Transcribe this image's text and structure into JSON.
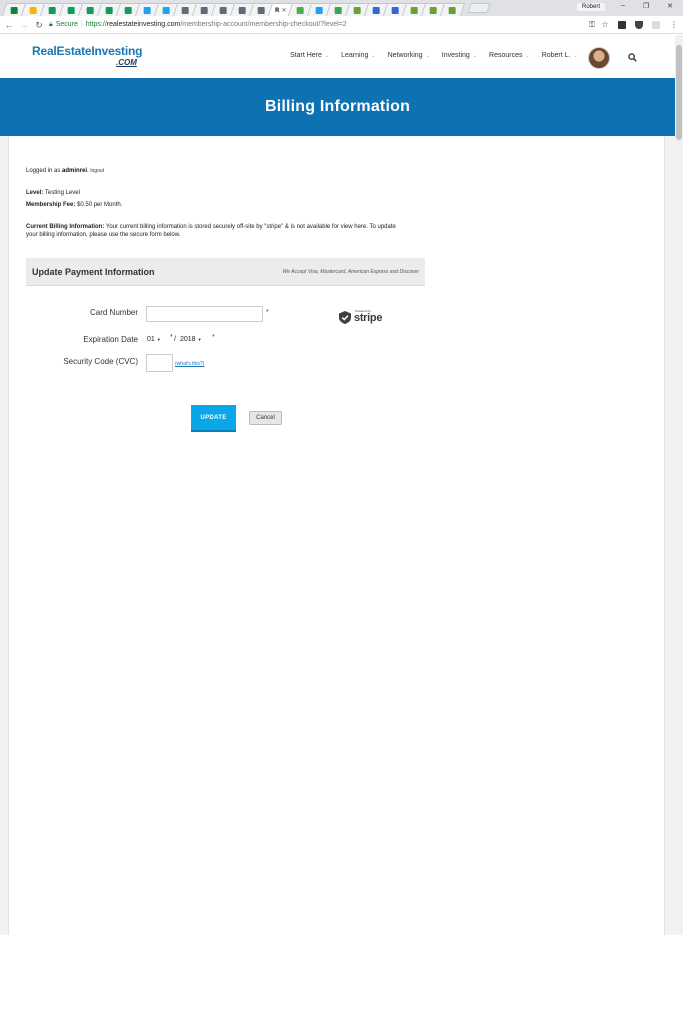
{
  "browser": {
    "user": "Robert",
    "secure_label": "Secure",
    "url_https": "https://",
    "url_host": "realestateinvesting.com",
    "url_path": "/membership-account/membership-checkout/?level=2",
    "active_tab_label": "R",
    "tabs": [
      {
        "icon": "spreadsheet-icon",
        "color": "#1a7f37"
      },
      {
        "icon": "drive-icon",
        "color": "#f4b400"
      },
      {
        "icon": "sheets-icon",
        "color": "#0f9d58"
      },
      {
        "icon": "sheets-icon",
        "color": "#0f9d58"
      },
      {
        "icon": "sheets-icon",
        "color": "#0f9d58"
      },
      {
        "icon": "sheets-icon",
        "color": "#0f9d58"
      },
      {
        "icon": "sheets-icon",
        "color": "#0f9d58"
      },
      {
        "icon": "twitter-icon",
        "color": "#1da1f2"
      },
      {
        "icon": "twitter-icon",
        "color": "#1da1f2"
      },
      {
        "icon": "doc-icon",
        "color": "#5f6b7a"
      },
      {
        "icon": "doc-icon",
        "color": "#5f6b7a"
      },
      {
        "icon": "doc-icon",
        "color": "#5f6b7a"
      },
      {
        "icon": "doc-icon",
        "color": "#5f6b7a"
      },
      {
        "icon": "doc-icon",
        "color": "#5f6b7a"
      }
    ],
    "tabs_right": [
      {
        "icon": "green-app-icon",
        "color": "#4caf50"
      },
      {
        "icon": "twitter-icon",
        "color": "#1da1f2"
      },
      {
        "icon": "green-circle-icon",
        "color": "#34a853"
      },
      {
        "icon": "tree-icon",
        "color": "#6a9f3a"
      },
      {
        "icon": "video-icon",
        "color": "#3367d6"
      },
      {
        "icon": "video-icon",
        "color": "#3367d6"
      },
      {
        "icon": "tree-icon",
        "color": "#6a9f3a"
      },
      {
        "icon": "tree-icon",
        "color": "#6a9f3a"
      },
      {
        "icon": "tree-icon",
        "color": "#6a9f3a"
      }
    ]
  },
  "site": {
    "logo_main": "RealEstateInvesting",
    "logo_com": ".COM",
    "nav": [
      {
        "label": "Start Here"
      },
      {
        "label": "Learning"
      },
      {
        "label": "Networking"
      },
      {
        "label": "Investing"
      },
      {
        "label": "Resources"
      },
      {
        "label": "Robert L."
      }
    ],
    "banner_title": "Billing Information"
  },
  "account": {
    "logged_in_prefix": "Logged in as ",
    "username": "adminrei",
    "logout": "logout",
    "level_label": "Level:",
    "level_value": " Testing Level",
    "fee_label": "Membership Fee:",
    "fee_value": " $0.50 per Month.",
    "billing_label": "Current Billing Information:",
    "billing_text": " Your current billing information is stored securely off-site by \"stripe\" & is not available for view here.  To update your billing information, please use the secure form below."
  },
  "payment": {
    "heading": "Update Payment Information",
    "accepted": "We Accept Visa, Mastercard, American Express and Discover",
    "card_label": "Card Number",
    "card_value": "",
    "exp_label": "Expiration Date",
    "exp_month": "01",
    "exp_separator": "/",
    "exp_year": "2018",
    "cvc_label": "Security Code (CVC)",
    "cvc_value": "",
    "whats_this": "what's this?",
    "required_mark": "*",
    "powered_by": "Powered by",
    "stripe_wordmark": "stripe",
    "update_button": "UPDATE",
    "cancel_button": "Cancel"
  }
}
